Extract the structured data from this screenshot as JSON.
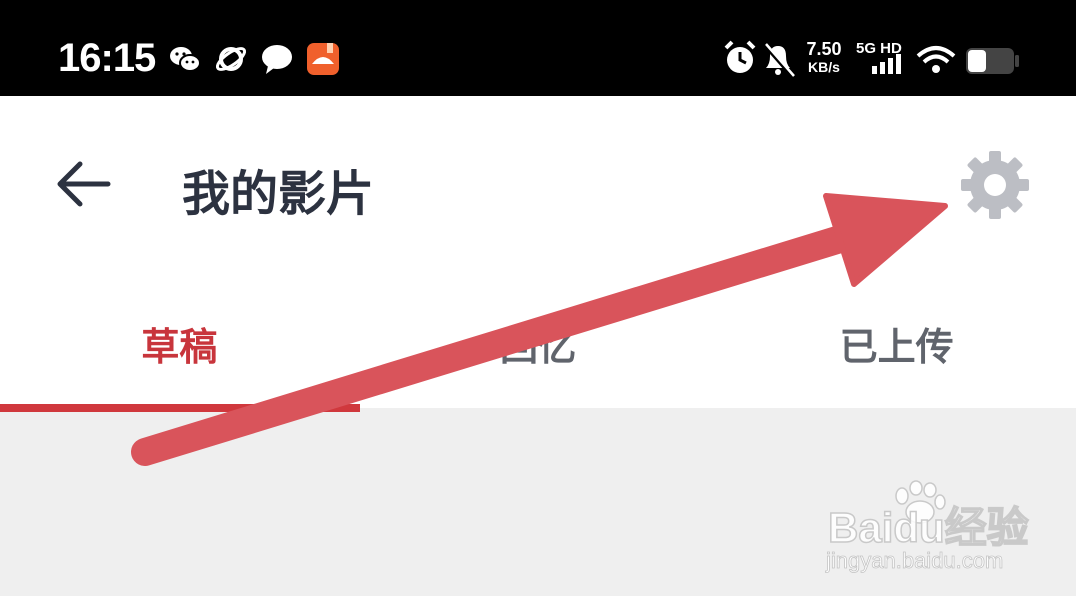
{
  "status_bar": {
    "time": "16:15",
    "notification_icons": [
      "wechat-icon",
      "planet-icon",
      "chat-bubble-icon",
      "reader-app-icon"
    ],
    "system_icons": [
      "alarm-icon",
      "muted-bell-icon",
      "signal-icon",
      "wifi-icon",
      "battery-icon"
    ],
    "network_speed_value": "7.50",
    "network_speed_unit": "KB/s",
    "network_type": "5G HD"
  },
  "app_bar": {
    "back_icon": "arrow-left-icon",
    "title": "我的影片",
    "settings_icon": "gear-icon"
  },
  "tabs": [
    {
      "label": "草稿",
      "active": true
    },
    {
      "label": "回忆",
      "active": false
    },
    {
      "label": "已上传",
      "active": false
    }
  ],
  "annotation": {
    "color": "#d9545b",
    "points_to": "settings-button"
  },
  "watermark": {
    "logo_text": "Baidu经验",
    "url": "jingyan.baidu.com"
  },
  "colors": {
    "accent": "#d0383d",
    "title": "#2c3240",
    "gear": "#bcbec4",
    "content_bg": "#efefef"
  }
}
